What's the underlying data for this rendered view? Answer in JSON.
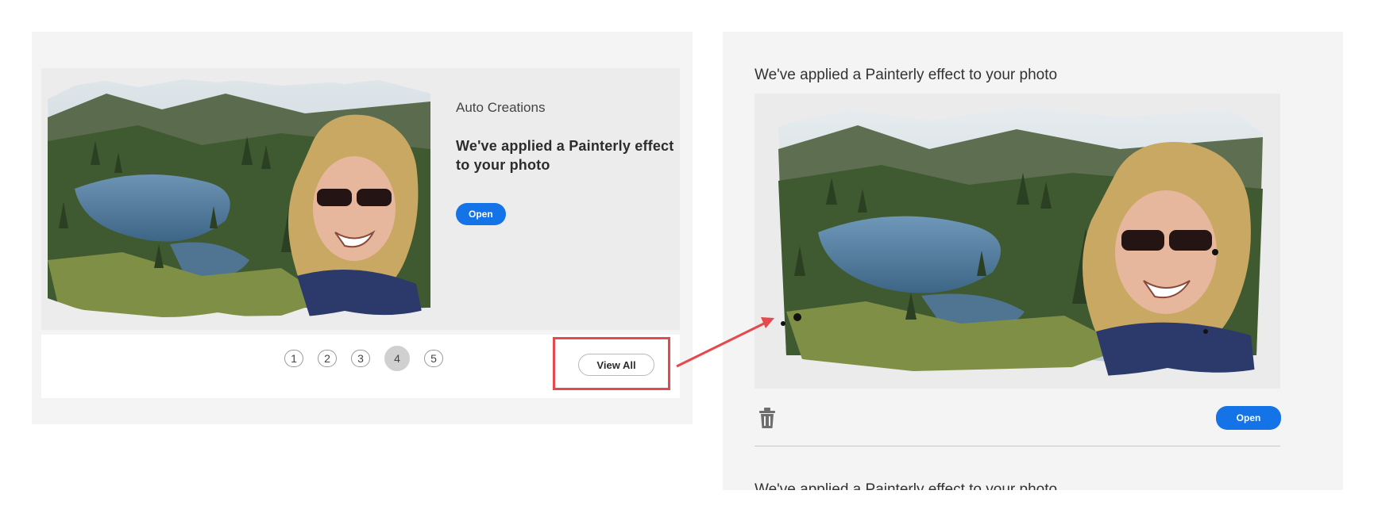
{
  "left_card": {
    "eyebrow": "Auto Creations",
    "title": "We've applied a Painterly effect to your photo",
    "open_label": "Open"
  },
  "pagination": {
    "pages": [
      "1",
      "2",
      "3",
      "4",
      "5"
    ],
    "active_page": 4,
    "view_all_label": "View All"
  },
  "right_panel": {
    "title": "We've applied a Painterly effect to your photo",
    "open_label": "Open",
    "next_item_text": "We've applied a Painterly effect to your photo"
  },
  "colors": {
    "accent": "#1473e6",
    "highlight": "#e5484d",
    "panel_bg": "#f4f4f4"
  },
  "icons": {
    "delete": "trash-icon",
    "annotation": "arrow-icon"
  }
}
